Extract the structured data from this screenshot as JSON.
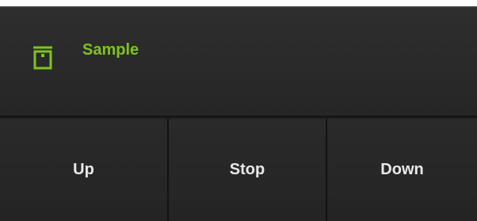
{
  "device": {
    "title": "Sample",
    "icon": "window-cover-icon",
    "accent_color": "#7fc41c"
  },
  "controls": {
    "up_label": "Up",
    "stop_label": "Stop",
    "down_label": "Down"
  }
}
